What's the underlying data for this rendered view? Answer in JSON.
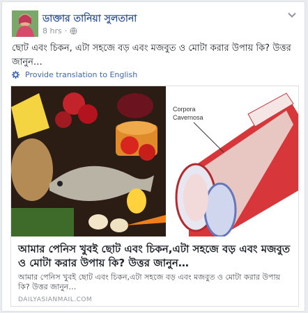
{
  "post": {
    "author": "ডাক্তার তানিয়া সুলতানা",
    "time": "8 hrs",
    "text": "ছোট এবং চিকন, এটা সহজে বড় এবং মজবুত ও মোটা করার উপায় কি? উত্তর জানুন…",
    "translate_label": "Provide translation to English",
    "audience_icon": "globe-icon"
  },
  "link_preview": {
    "image_left_icon": "food-spread-illustration",
    "image_right_label": "Corpora Cavernosa",
    "title": "আমার পেনিস খুবই ছোট এবং চিকন,এটা সহজে বড় এবং মজবুত ও মোটা করার উপায় কি? উত্তর জানুন…",
    "description": "আমার পেনিস খুবই ছোট এবং চিকন,এটা সহজে বড় এবং মজবুত ও মোটা করার উপায় কি? উত্তর জানুন…",
    "domain": "DAILYASIANMAIL.COM"
  },
  "colors": {
    "link_blue": "#365899",
    "text": "#1d2129",
    "meta_gray": "#90949c",
    "background": "#e9ebee"
  }
}
